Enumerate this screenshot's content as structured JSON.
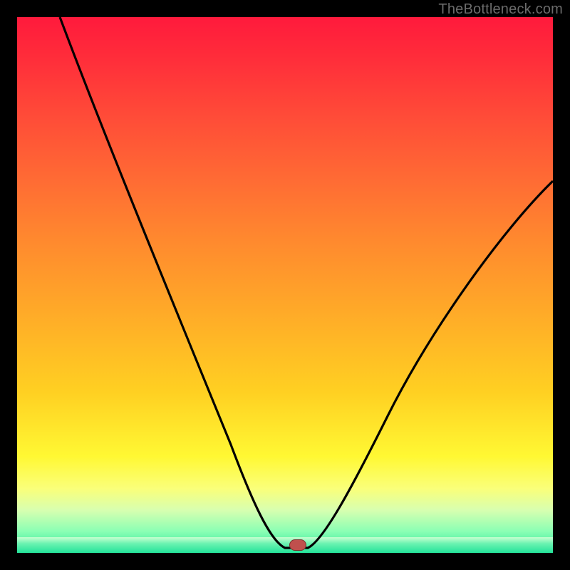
{
  "watermark": "TheBottleneck.com",
  "chart_data": {
    "type": "line",
    "title": "",
    "xlabel": "",
    "ylabel": "",
    "xlim": [
      0,
      100
    ],
    "ylim": [
      0,
      100
    ],
    "grid": false,
    "x": [
      0,
      5,
      10,
      15,
      20,
      25,
      30,
      35,
      40,
      45,
      48,
      50,
      52,
      55,
      58,
      62,
      66,
      70,
      75,
      80,
      85,
      90,
      95,
      100
    ],
    "series": [
      {
        "name": "bottleneck-curve",
        "values": [
          100,
          90,
          80,
          70,
          60,
          50,
          40,
          29,
          18,
          7,
          2,
          0,
          0,
          0,
          2,
          7,
          13,
          19,
          27,
          35,
          43,
          51,
          59,
          67
        ]
      }
    ],
    "marker": {
      "x": 52,
      "y": 0,
      "color": "#c0504d"
    },
    "background_gradient": {
      "stops": [
        {
          "pos": 0.0,
          "color": "#ff1a3c"
        },
        {
          "pos": 0.3,
          "color": "#ff6a34"
        },
        {
          "pos": 0.55,
          "color": "#ffaa28"
        },
        {
          "pos": 0.82,
          "color": "#fff833"
        },
        {
          "pos": 0.96,
          "color": "#8affb4"
        },
        {
          "pos": 1.0,
          "color": "#24e39a"
        }
      ]
    }
  }
}
